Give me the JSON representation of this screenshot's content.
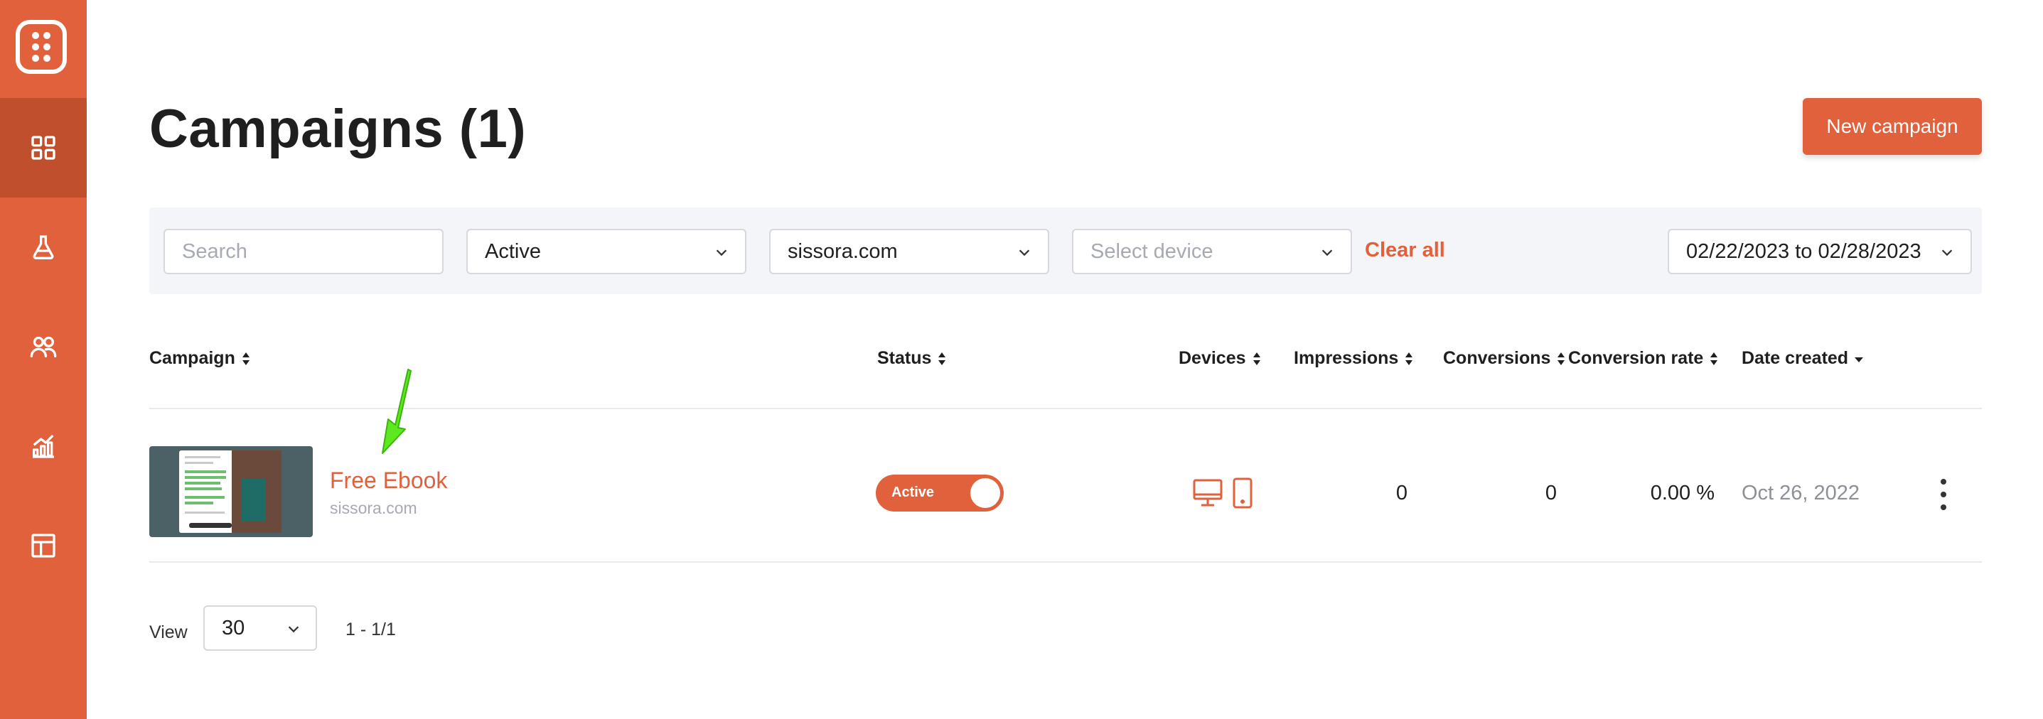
{
  "sidebar": {
    "items": [
      {
        "name": "dashboard",
        "icon": "grid-icon",
        "active": true
      },
      {
        "name": "experiments",
        "icon": "flask-icon",
        "active": false
      },
      {
        "name": "audience",
        "icon": "users-icon",
        "active": false
      },
      {
        "name": "analytics",
        "icon": "chart-icon",
        "active": false
      },
      {
        "name": "templates",
        "icon": "layout-icon",
        "active": false
      }
    ],
    "color": "#e0613b",
    "active_color": "#c0502d"
  },
  "header": {
    "title": "Campaigns (1)",
    "new_button_label": "New campaign"
  },
  "filters": {
    "search_placeholder": "Search",
    "status_value": "Active",
    "domain_value": "sissora.com",
    "device_placeholder": "Select device",
    "clear_label": "Clear all",
    "date_range": "02/22/2023 to 02/28/2023"
  },
  "table": {
    "columns": {
      "campaign": "Campaign",
      "status": "Status",
      "devices": "Devices",
      "impressions": "Impressions",
      "conversions": "Conversions",
      "conversion_rate": "Conversion rate",
      "date_created": "Date created"
    },
    "rows": [
      {
        "name": "Free Ebook",
        "domain": "sissora.com",
        "status": "Active",
        "devices": [
          "desktop-icon",
          "mobile-icon"
        ],
        "impressions": "0",
        "conversions": "0",
        "conversion_rate": "0.00 %",
        "date_created": "Oct 26, 2022"
      }
    ]
  },
  "pagination": {
    "view_label": "View",
    "per_page": "30",
    "range": "1 - 1/1"
  },
  "accent_color": "#e0613b"
}
